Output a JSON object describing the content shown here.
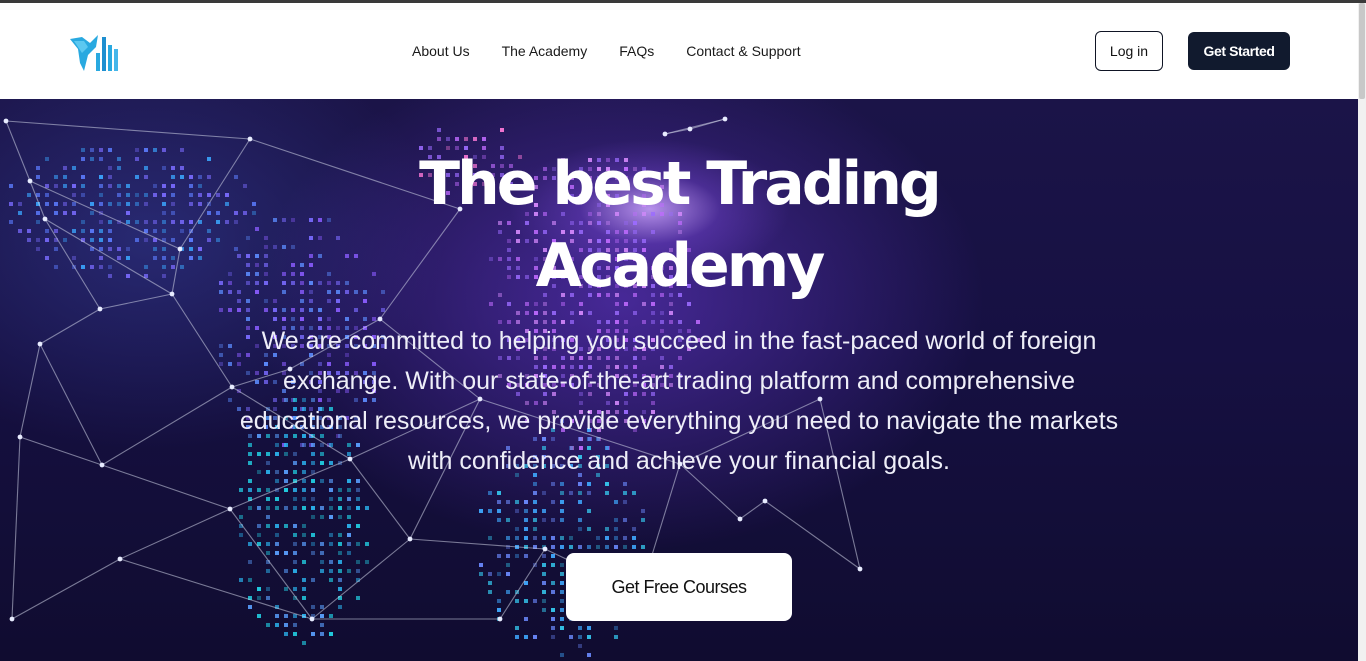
{
  "header": {
    "logo_icon": "bar-chart-logo",
    "nav": [
      {
        "label": "About Us"
      },
      {
        "label": "The Academy"
      },
      {
        "label": "FAQs"
      },
      {
        "label": "Contact & Support"
      }
    ],
    "login_label": "Log in",
    "get_started_label": "Get Started"
  },
  "hero": {
    "title_line1": "The best Trading",
    "title_line2": "Academy",
    "description": "We are committed to helping you succeed in the fast-paced world of foreign exchange. With our state-of-the-art trading platform and comprehensive educational resources, we provide everything you need to navigate the markets with confidence and achieve your financial goals.",
    "cta_label": "Get Free Courses",
    "background_image": "dotted-world-map-network"
  },
  "colors": {
    "primary_dark": "#111a2e",
    "hero_bg": "#161042",
    "accent_glow": "#a77bff",
    "logo_blue": "#29a9e0"
  }
}
